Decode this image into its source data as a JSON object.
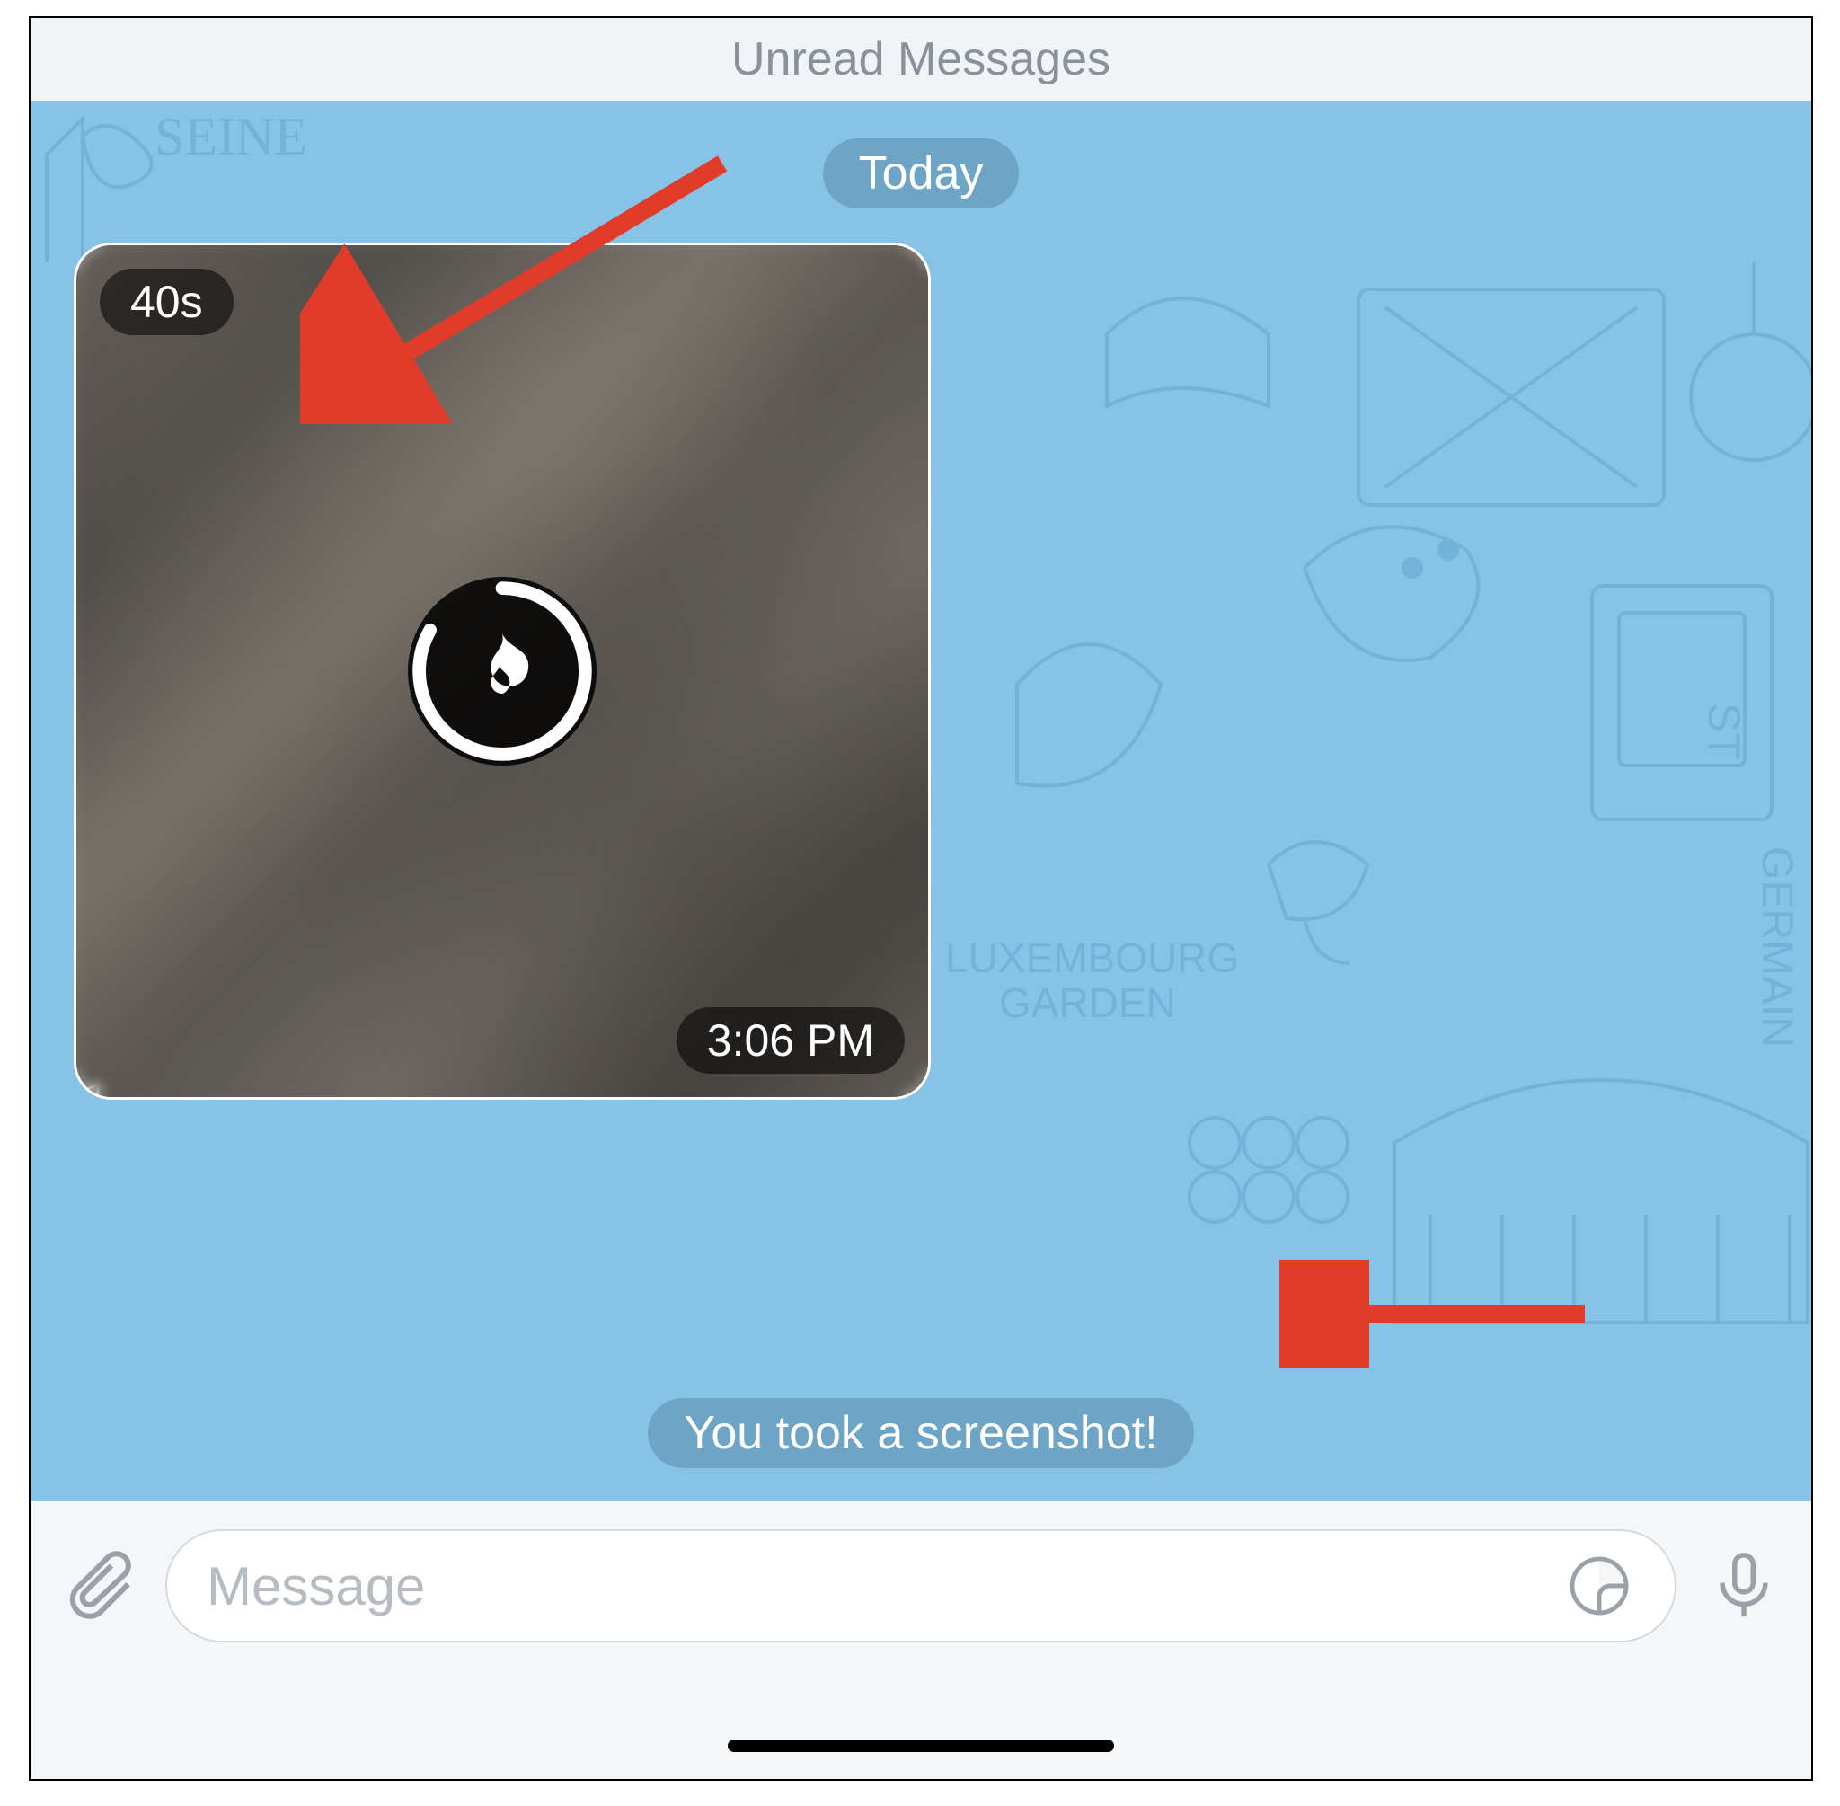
{
  "header": {
    "title": "Unread Messages"
  },
  "chat": {
    "date_label": "Today",
    "system_message": "You took a screenshot!",
    "message": {
      "timer": "40s",
      "timestamp": "3:06 PM",
      "icon": "flame-icon"
    }
  },
  "input": {
    "placeholder": "Message",
    "attach_icon": "paperclip-icon",
    "sticker_icon": "sticker-icon",
    "mic_icon": "microphone-icon"
  },
  "annotations": {
    "arrow_top": "arrow-top-left",
    "arrow_bottom": "arrow-right-left"
  },
  "colors": {
    "chat_bg": "#86c3e6",
    "pill_bg": "rgba(91,139,170,0.55)",
    "arrow": "#e13b2a"
  }
}
